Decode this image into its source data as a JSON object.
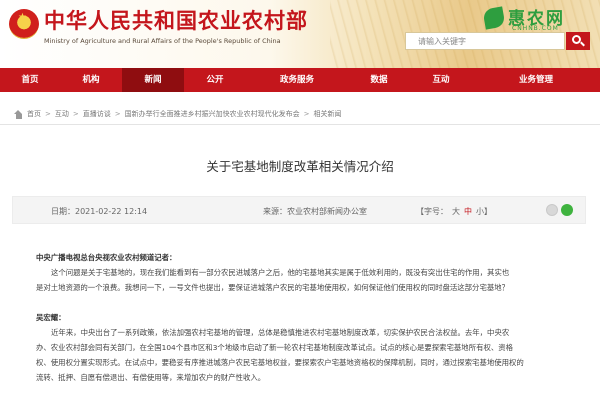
{
  "colors": {
    "brand_red": "#c4161c",
    "nav_active": "#8f0d10",
    "partner_green": "#2e9e3f"
  },
  "header": {
    "site_title": "中华人民共和国农业农村部",
    "site_subtitle": "Ministry of Agriculture and Rural Affairs of the People's Republic of China",
    "emblem_icon": "national-emblem-icon",
    "partner": {
      "name": "惠农网",
      "domain": "CNHNB.COM",
      "logo_icon": "leaf-logo-icon"
    },
    "search": {
      "placeholder": "请输入关键字",
      "button_icon": "search-icon"
    }
  },
  "nav": {
    "items": [
      {
        "label": "首页",
        "active": false
      },
      {
        "label": "机构",
        "active": false
      },
      {
        "label": "新闻",
        "active": true
      },
      {
        "label": "公开",
        "active": false
      },
      {
        "label": "政务服务",
        "active": false
      },
      {
        "label": "数据",
        "active": false
      },
      {
        "label": "互动",
        "active": false
      },
      {
        "label": "业务管理",
        "active": false
      }
    ]
  },
  "breadcrumb": {
    "home_icon": "home-icon",
    "items": [
      "首页",
      "互动",
      "直播访谈",
      "国新办举行全面推进乡村振兴加快农业农村现代化发布会",
      "相关新闻"
    ],
    "separator": ">"
  },
  "article": {
    "title": "关于宅基地制度改革相关情况介绍",
    "date_label": "日期：",
    "date": "2021-02-22 12:14",
    "source_label": "来源：",
    "source": "农业农村部新闻办公室",
    "size_label": "【字号：",
    "size_options": [
      "大",
      "中",
      "小"
    ],
    "size_active": "中",
    "size_close": "】",
    "share_icons": [
      "weibo-icon",
      "wechat-icon"
    ],
    "paragraphs": [
      {
        "kind": "speaker",
        "lines": [
          "中央广播电视总台央视农业农村频道记者："
        ]
      },
      {
        "kind": "text",
        "lines": [
          "这个问题是关于宅基地的，现在我们能看到有一部分农民进城落户之后，他的宅基地其实是属于低效利用的，既没有突出住宅的作用，其实也",
          "是对土地资源的一个浪费。我想问一下，一号文件也提出，要保证进城落户农民的宅基地使用权，如何保证他们使用权的同时盘活这部分宅基地？"
        ]
      },
      {
        "kind": "speaker",
        "lines": [
          "吴宏耀："
        ]
      },
      {
        "kind": "text",
        "lines": [
          "近年来，中央出台了一系列政策，依法加强农村宅基地的管理，总体是稳慎推进农村宅基地制度改革，切实保护农民合法权益。去年，中央农",
          "办、农业农村部会同有关部门，在全国104个县市区和3个地级市启动了新一轮农村宅基地制度改革试点。试点的核心是要探索宅基地所有权、资格",
          "权、使用权分置实现形式。在试点中，要稳妥有序推进城落户农民宅基地权益，要探索农户宅基地资格权的保障机制，同时，通过探索宅基地使用权的",
          "流转、抵押、自愿有偿退出、有偿使用等，来增加农户的财产性收入。"
        ]
      }
    ]
  }
}
